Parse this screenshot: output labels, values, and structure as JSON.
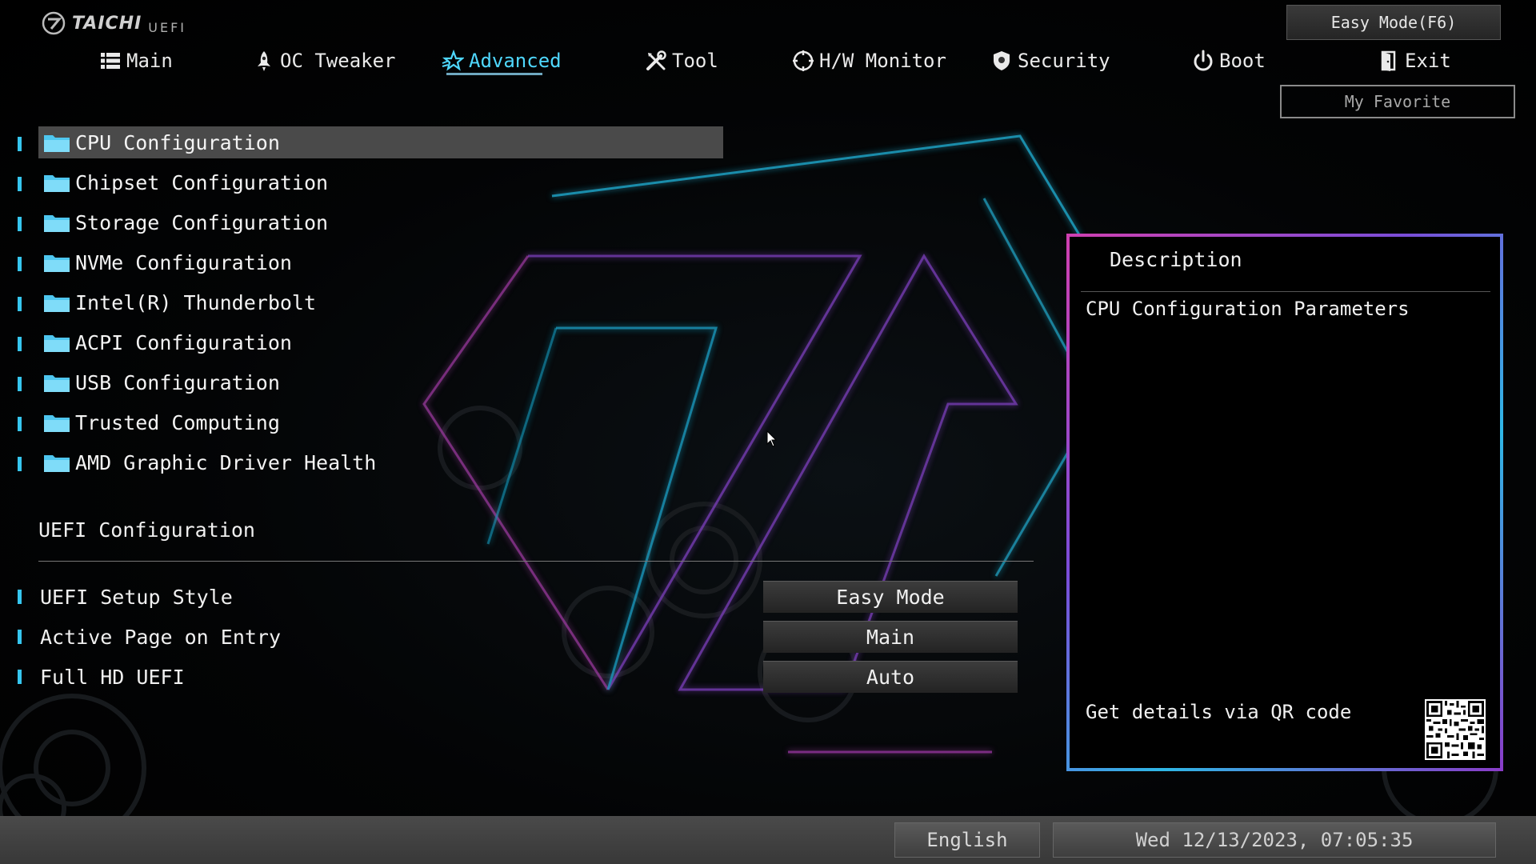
{
  "brand": {
    "name": "TAICHI",
    "sub": "UEFI"
  },
  "nav": {
    "tabs": [
      {
        "label": "Main",
        "icon": "list-icon"
      },
      {
        "label": "OC Tweaker",
        "icon": "rocket-icon"
      },
      {
        "label": "Advanced",
        "icon": "star-icon",
        "active": true
      },
      {
        "label": "Tool",
        "icon": "tools-icon"
      },
      {
        "label": "H/W Monitor",
        "icon": "monitor-icon"
      },
      {
        "label": "Security",
        "icon": "shield-icon"
      },
      {
        "label": "Boot",
        "icon": "power-icon"
      },
      {
        "label": "Exit",
        "icon": "exit-door-icon"
      }
    ],
    "easy_mode_label": "Easy Mode(F6)",
    "favorite_label": "My Favorite"
  },
  "menu": {
    "items": [
      {
        "label": "CPU Configuration",
        "selected": true
      },
      {
        "label": "Chipset Configuration"
      },
      {
        "label": "Storage Configuration"
      },
      {
        "label": "NVMe Configuration"
      },
      {
        "label": "Intel(R) Thunderbolt"
      },
      {
        "label": "ACPI Configuration"
      },
      {
        "label": "USB Configuration"
      },
      {
        "label": "Trusted Computing"
      },
      {
        "label": "AMD Graphic Driver Health"
      }
    ]
  },
  "uefi_config": {
    "title": "UEFI Configuration",
    "settings": [
      {
        "label": "UEFI Setup Style",
        "value": "Easy Mode"
      },
      {
        "label": "Active Page on Entry",
        "value": "Main"
      },
      {
        "label": "Full HD UEFI",
        "value": "Auto"
      }
    ]
  },
  "description": {
    "title": "Description",
    "text": "CPU Configuration Parameters",
    "qr_label": "Get details via QR code"
  },
  "status": {
    "language": "English",
    "datetime": "Wed 12/13/2023, 07:05:35"
  },
  "colors": {
    "accent": "#4fd8ff",
    "bullet": "#36c6ef",
    "selection": "#4a4a4a",
    "panel_border_magenta": "#d040b0",
    "panel_border_cyan": "#2fb7e6"
  }
}
